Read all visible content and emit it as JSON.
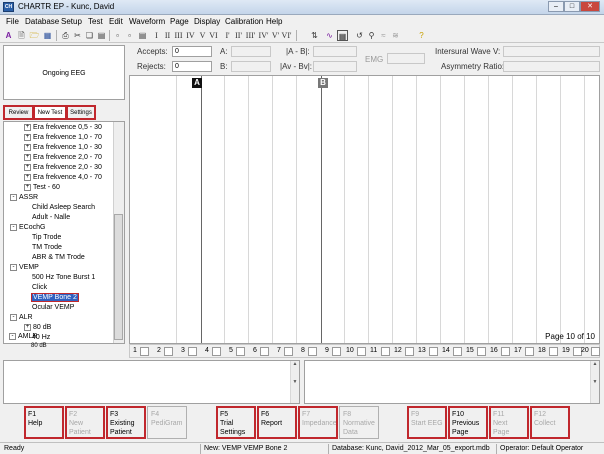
{
  "title": "CHARTR EP - Kunc, David",
  "app_icon_text": "CH",
  "menu": [
    "File",
    "Database",
    "Setup",
    "Test",
    "Edit",
    "Waveform",
    "Page",
    "Display",
    "Calibration",
    "Help"
  ],
  "toolbar_icons": [
    "trace-a-icon",
    "new-icon",
    "open-icon",
    "save-icon",
    "print-icon",
    "cut-icon",
    "copy-icon",
    "paste-icon",
    "page-icon",
    "page2-icon",
    "report-icon",
    "wave-i-icon",
    "wave-ii-icon",
    "wave-iii-icon",
    "wave-iv-icon",
    "wave-v-icon",
    "wave-vi-icon",
    "wave-i-prime-icon",
    "wave-ii-prime-icon",
    "wave-iii-prime-icon",
    "wave-iv-prime-icon",
    "wave-v-prime-icon",
    "wave-vi-prime-icon",
    "cursor-icon",
    "wave-icon",
    "grid-icon",
    "rotate-icon",
    "search-icon",
    "smooth-icon",
    "filter-icon",
    "help-icon"
  ],
  "left_panel": {
    "ongoing": "Ongoing EEG"
  },
  "tabs": [
    "Review",
    "New Test",
    "Settings"
  ],
  "tree": [
    {
      "label": "Era frekvence 0,5 - 30",
      "expandable": true
    },
    {
      "label": "Era frekvence 1,0 - 70",
      "expandable": true
    },
    {
      "label": "Era frekvence 1,0 - 30",
      "expandable": true
    },
    {
      "label": "Era frekvence 2,0 - 70",
      "expandable": true
    },
    {
      "label": "Era frekvence 2,0 - 30",
      "expandable": true
    },
    {
      "label": "Era frekvence 4,0 - 70",
      "expandable": true
    },
    {
      "label": "Test - 60",
      "expandable": true
    },
    {
      "label": "ASSR",
      "expandable": true,
      "group": true
    },
    {
      "label": "Child Asleep Search",
      "expandable": false
    },
    {
      "label": "Adult - Nalle",
      "expandable": false
    },
    {
      "label": "ECochG",
      "expandable": true,
      "group": true
    },
    {
      "label": "Tip Trode",
      "expandable": false
    },
    {
      "label": "TM Trode",
      "expandable": false
    },
    {
      "label": "ABR & TM Trode",
      "expandable": false
    },
    {
      "label": "VEMP",
      "expandable": true,
      "group": true
    },
    {
      "label": "500 Hz Tone Burst 1",
      "expandable": false
    },
    {
      "label": "Click",
      "expandable": false
    },
    {
      "label": "VEMP Bone 2",
      "expandable": false,
      "selected": true
    },
    {
      "label": "Ocular VEMP",
      "expandable": false
    },
    {
      "label": "ALR",
      "expandable": true,
      "group": true
    },
    {
      "label": "80 dB",
      "expandable": true
    },
    {
      "label": "40 Hz",
      "expandable": false
    },
    {
      "label": "AMLR",
      "expandable": true,
      "group": true
    },
    {
      "label": "80 dB",
      "expandable": false
    }
  ],
  "fields": {
    "accepts_label": "Accepts:",
    "accepts_value": "0",
    "rejects_label": "Rejects:",
    "rejects_value": "0",
    "a_label": "A:",
    "b_label": "B:",
    "ab_label": "|A - B|:",
    "avbv_label": "|Av - Bv|:",
    "emg_label": "EMG",
    "interaural_label": "Intersural Wave V:",
    "asymmetry_label": "Asymmetry Ratio:"
  },
  "markers": {
    "a": "A",
    "b": "B"
  },
  "page_label": "Page 10 of 10",
  "ruler": [
    "1",
    "2",
    "3",
    "4",
    "5",
    "6",
    "7",
    "8",
    "9",
    "10",
    "11",
    "12",
    "13",
    "14",
    "15",
    "16",
    "17",
    "18",
    "19",
    "20"
  ],
  "fkeys": [
    {
      "key": "F1",
      "label": "Help",
      "enabled": true
    },
    {
      "key": "F2",
      "label": "New Patient",
      "enabled": false
    },
    {
      "key": "F3",
      "label": "Existing Patient",
      "enabled": true
    },
    {
      "key": "F4",
      "label": "PediGram",
      "enabled": false
    },
    {
      "key": "F5",
      "label": "Trial Settings",
      "enabled": true
    },
    {
      "key": "F6",
      "label": "Report",
      "enabled": true
    },
    {
      "key": "F7",
      "label": "Impedance",
      "enabled": false
    },
    {
      "key": "F8",
      "label": "Normative Data",
      "enabled": false
    },
    {
      "key": "F9",
      "label": "Start EEG",
      "enabled": false
    },
    {
      "key": "F10",
      "label": "Previous Page",
      "enabled": true
    },
    {
      "key": "F11",
      "label": "Next Page",
      "enabled": false
    },
    {
      "key": "F12",
      "label": "Collect",
      "enabled": false
    }
  ],
  "status": {
    "ready": "Ready",
    "new": "New: VEMP VEMP Bone 2",
    "database": "Database: Kunc, David_2012_Mar_05_export.mdb",
    "operator": "Operator: Default Operator"
  },
  "colors": {
    "accent_red": "#c0272d",
    "selection": "#3060c0",
    "marker_a": "#111111",
    "marker_b": "#777777"
  }
}
